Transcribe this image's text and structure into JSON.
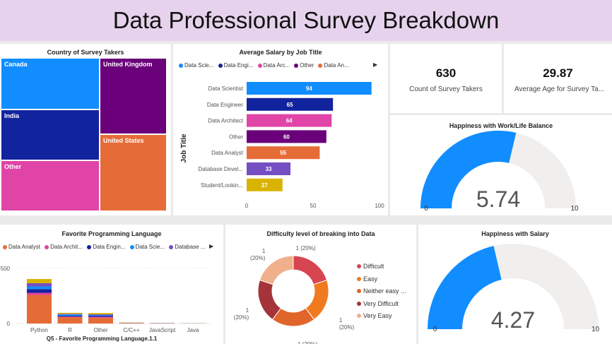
{
  "page_title": "Data Professional Survey Breakdown",
  "treemap": {
    "title": "Country of Survey Takers",
    "cells": [
      {
        "label": "Canada",
        "color": "#118dff"
      },
      {
        "label": "United Kingdom",
        "color": "#6b007b"
      },
      {
        "label": "India",
        "color": "#12239e"
      },
      {
        "label": "United States",
        "color": "#e66c37"
      },
      {
        "label": "Other",
        "color": "#e044a7"
      }
    ]
  },
  "salary_chart": {
    "title": "Average Salary by Job Title",
    "legend": [
      {
        "label": "Data Scie...",
        "color": "#118dff"
      },
      {
        "label": "Data Engi...",
        "color": "#12239e"
      },
      {
        "label": "Data Arc...",
        "color": "#e044a7"
      },
      {
        "label": "Other",
        "color": "#6b007b"
      },
      {
        "label": "Data An...",
        "color": "#e66c37"
      }
    ],
    "ylabel": "Job Title"
  },
  "kpis": {
    "count_value": "630",
    "count_label": "Count of Survey Takers",
    "age_value": "29.87",
    "age_label": "Average Age for Survey Ta..."
  },
  "gauge_worklife": {
    "title": "Happiness with Work/Life Balance",
    "value": 5.74,
    "value_text": "5.74",
    "min": "0",
    "max": "10",
    "fill_color": "#118dff",
    "track_color": "#f0efee"
  },
  "gauge_salary": {
    "title": "Happiness with Salary",
    "value": 4.27,
    "value_text": "4.27",
    "min": "0",
    "max": "10",
    "fill_color": "#118dff",
    "track_color": "#f0efee"
  },
  "lang_chart": {
    "title": "Favorite Programming Language",
    "legend": [
      {
        "label": "Data Analyst",
        "color": "#e66c37"
      },
      {
        "label": "Data Archit...",
        "color": "#e044a7"
      },
      {
        "label": "Data Engin...",
        "color": "#12239e"
      },
      {
        "label": "Data Scie...",
        "color": "#118dff"
      },
      {
        "label": "Database ...",
        "color": "#744ec2"
      }
    ],
    "xlabel": "Q5 - Favorite Programming Language.1.1"
  },
  "donut": {
    "title": "Difficulty level of breaking into Data",
    "legend": [
      {
        "label": "Difficult",
        "color": "#d64550"
      },
      {
        "label": "Easy",
        "color": "#f07a1f"
      },
      {
        "label": "Neither easy ...",
        "color": "#e0652a"
      },
      {
        "label": "Very Difficult",
        "color": "#a4343a"
      },
      {
        "label": "Very Easy",
        "color": "#f0b08c"
      }
    ]
  },
  "chart_data": [
    {
      "type": "bar",
      "title": "Average Salary by Job Title",
      "orientation": "horizontal",
      "ylabel": "Job Title",
      "categories": [
        "Data Scientist",
        "Data Engineer",
        "Data Architect",
        "Other",
        "Data Analyst",
        "Database Devel...",
        "Student/Lookin..."
      ],
      "values": [
        94,
        65,
        64,
        60,
        55,
        33,
        27
      ],
      "colors": [
        "#118dff",
        "#12239e",
        "#e044a7",
        "#6b007b",
        "#e66c37",
        "#744ec2",
        "#d9b300"
      ],
      "xticks": [
        "0",
        "50",
        "100"
      ],
      "xlim": [
        0,
        100
      ]
    },
    {
      "type": "bar",
      "stacked": true,
      "title": "Favorite Programming Language",
      "xlabel": "Q5 - Favorite Programming Language.1.1",
      "categories": [
        "Python",
        "R",
        "Other",
        "C/C++",
        "JavaScript",
        "Java"
      ],
      "series": [
        {
          "name": "Data Analyst",
          "color": "#e66c37",
          "values": [
            270,
            60,
            55,
            4,
            2,
            1
          ]
        },
        {
          "name": "Data Architect",
          "color": "#e044a7",
          "values": [
            20,
            5,
            8,
            1,
            1,
            0
          ]
        },
        {
          "name": "Data Engineer",
          "color": "#12239e",
          "values": [
            35,
            8,
            10,
            1,
            1,
            1
          ]
        },
        {
          "name": "Data Scientist",
          "color": "#118dff",
          "values": [
            25,
            12,
            6,
            1,
            1,
            0
          ]
        },
        {
          "name": "Database ...",
          "color": "#744ec2",
          "values": [
            30,
            6,
            8,
            1,
            0,
            0
          ]
        },
        {
          "name": "",
          "color": "#d9b300",
          "values": [
            40,
            10,
            12,
            2,
            1,
            1
          ]
        }
      ],
      "yticks": [
        "0",
        "500"
      ],
      "ylim": [
        0,
        520
      ]
    },
    {
      "type": "pie",
      "donut": true,
      "title": "Difficulty level of breaking into Data",
      "categories": [
        "Difficult",
        "Easy",
        "Neither easy ...",
        "Very Difficult",
        "Very Easy"
      ],
      "values": [
        1,
        1,
        1,
        1,
        1
      ],
      "labels": [
        "1 (20%)",
        "1 (20%)",
        "1 (20%)",
        "1 (20%)",
        "1 (20%)"
      ],
      "colors": [
        "#d64550",
        "#f07a1f",
        "#e0652a",
        "#a4343a",
        "#f0b08c"
      ]
    }
  ]
}
